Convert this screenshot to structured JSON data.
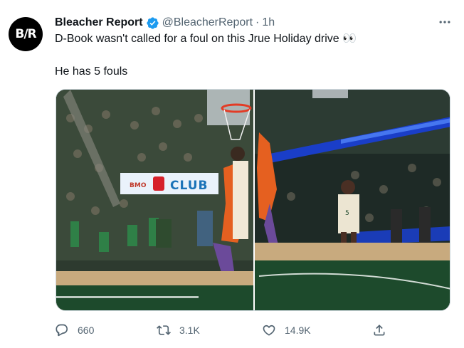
{
  "tweet": {
    "avatar_text": "B/R",
    "display_name": "Bleacher Report",
    "handle": "@BleacherReport",
    "separator": "·",
    "time": "1h",
    "line1": "D-Book wasn't called for a foul on this Jrue Holiday drive 👀",
    "line2": "He has 5 fouls",
    "media": {
      "left_sign_text": "BMO",
      "left_sign_club": "CLUB",
      "jersey_number": "5"
    },
    "actions": {
      "replies": "660",
      "retweets": "3.1K",
      "likes": "14.9K"
    }
  },
  "colors": {
    "verified_blue": "#1d9bf0",
    "text_secondary": "#536471",
    "court_green": "#1d4a2c",
    "suns_orange": "#e56020"
  },
  "icons": {
    "verified": "verified-badge-icon",
    "more": "more-icon",
    "reply": "reply-icon",
    "retweet": "retweet-icon",
    "like": "heart-icon",
    "share": "share-icon"
  }
}
